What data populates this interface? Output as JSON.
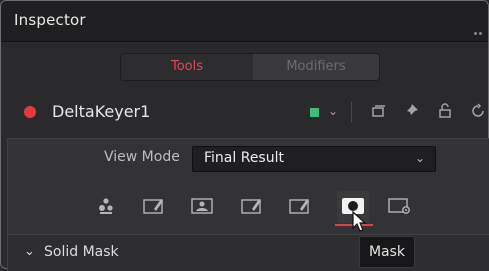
{
  "panel": {
    "title": "Inspector"
  },
  "tabs": [
    {
      "label": "Tools",
      "active": true
    },
    {
      "label": "Modifiers",
      "active": false
    }
  ],
  "node": {
    "name": "DeltaKeyer1",
    "status_color": "#e43a3f",
    "color_swatch": "#3dbf79"
  },
  "view_mode": {
    "label": "View Mode",
    "value": "Final Result"
  },
  "toolbar_icons": [
    "color-pick-icon",
    "eyedropper-icon",
    "image-icon",
    "eyedropper-icon",
    "eyedropper-icon",
    "mask-icon",
    "settings-icon"
  ],
  "section": {
    "label": "Solid Mask",
    "expanded": true
  },
  "tooltip": {
    "text": "Mask"
  },
  "accent": "#d8424c"
}
